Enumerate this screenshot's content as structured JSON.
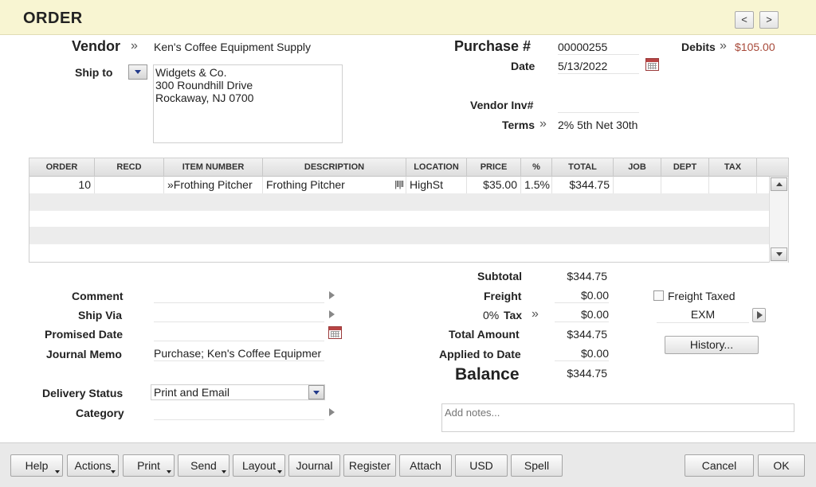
{
  "header": {
    "title": "ORDER",
    "prev_label": "<",
    "next_label": ">"
  },
  "vendor": {
    "label": "Vendor",
    "chevron": "»",
    "value": "Ken's Coffee Equipment Supply"
  },
  "ship_to": {
    "label": "Ship to",
    "address_lines": [
      "Widgets & Co.",
      "300 Roundhill Drive",
      "Rockaway, NJ 0700"
    ]
  },
  "purchase": {
    "label": "Purchase #",
    "value": "00000255"
  },
  "date": {
    "label": "Date",
    "value": "5/13/2022"
  },
  "debits": {
    "label": "Debits",
    "chevron": "»",
    "value": "$105.00",
    "color": "#a84a3a"
  },
  "vendor_inv": {
    "label": "Vendor Inv#",
    "value": ""
  },
  "terms": {
    "label": "Terms",
    "chevron": "»",
    "value": "2% 5th Net 30th"
  },
  "table": {
    "columns": [
      "ORDER",
      "RECD",
      "ITEM NUMBER",
      "DESCRIPTION",
      "LOCATION",
      "PRICE",
      "%",
      "TOTAL",
      "JOB",
      "DEPT",
      "TAX"
    ],
    "rows": [
      {
        "order": "10",
        "recd": "",
        "item_chevron": "»",
        "item_number": "Frothing Pitcher",
        "description": "Frothing Pitcher",
        "location": "HighSt",
        "price": "$35.00",
        "pct": "1.5%",
        "total": "$344.75",
        "job": "",
        "dept": "",
        "tax": ""
      }
    ]
  },
  "left_fields": {
    "comment": {
      "label": "Comment",
      "value": ""
    },
    "ship_via": {
      "label": "Ship Via",
      "value": ""
    },
    "promised_date": {
      "label": "Promised Date",
      "value": ""
    },
    "journal_memo": {
      "label": "Journal Memo",
      "value": "Purchase; Ken's Coffee Equipmer"
    },
    "delivery_status": {
      "label": "Delivery Status",
      "value": "Print and Email"
    },
    "category": {
      "label": "Category",
      "value": ""
    }
  },
  "totals": {
    "subtotal": {
      "label": "Subtotal",
      "value": "$344.75"
    },
    "freight": {
      "label": "Freight",
      "value": "$0.00"
    },
    "tax": {
      "rate": "0%",
      "label": "Tax",
      "chevron": "»",
      "value": "$0.00"
    },
    "total_amount": {
      "label": "Total Amount",
      "value": "$344.75"
    },
    "applied": {
      "label": "Applied to Date",
      "value": "$0.00"
    },
    "balance": {
      "label": "Balance",
      "value": "$344.75"
    }
  },
  "freight_taxed": {
    "label": "Freight Taxed",
    "checked": false
  },
  "tax_code": {
    "value": "EXM"
  },
  "history_button": "History...",
  "notes": {
    "placeholder": "Add notes..."
  },
  "footer": {
    "help": "Help",
    "actions": "Actions",
    "print": "Print",
    "send": "Send",
    "layout": "Layout",
    "journal": "Journal",
    "register": "Register",
    "attach": "Attach",
    "usd": "USD",
    "spell": "Spell",
    "cancel": "Cancel",
    "ok": "OK"
  }
}
